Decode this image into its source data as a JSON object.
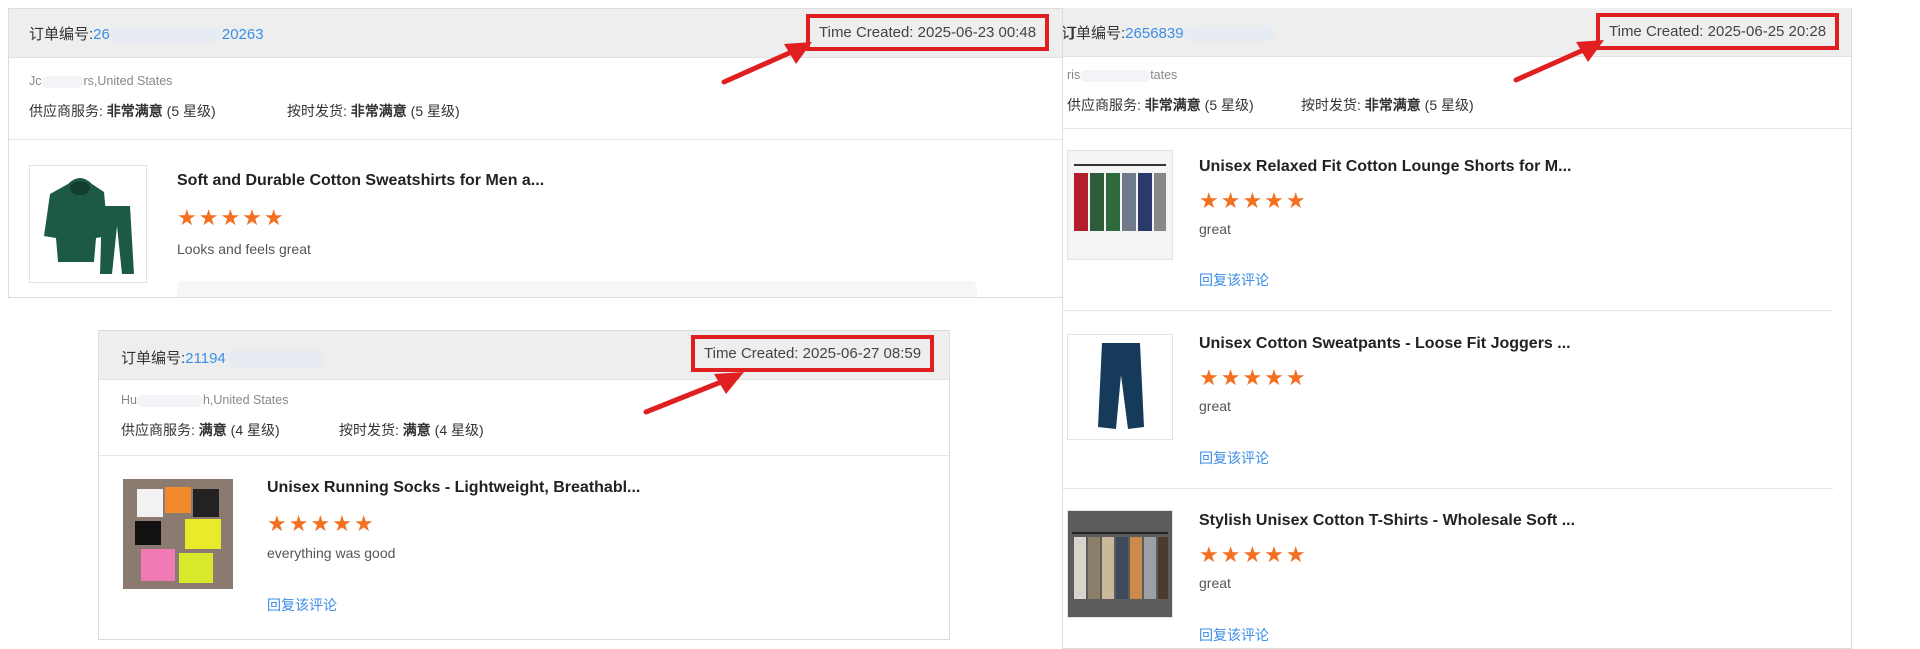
{
  "order_label": "订单编号:",
  "time_label": "Time Created:",
  "cards": {
    "c1": {
      "order_prefix": "26",
      "order_suffix": "20263",
      "time": "2025-06-23 00:48",
      "addr_prefix": "Jc",
      "addr_suffix": "rs,United States",
      "svc_label": "供应商服务:",
      "svc_value": "非常满意",
      "svc_level": "(5 星级)",
      "ship_label": "按时发货:",
      "ship_value": "非常满意",
      "ship_level": "(5 星级)",
      "product_title": "Soft and Durable Cotton Sweatshirts for Men a...",
      "stars": "★★★★★",
      "review": "Looks and feels great"
    },
    "c2": {
      "order_prefix": "21194",
      "time": "2025-06-27 08:59",
      "addr_prefix": "Hu",
      "addr_suffix": "h,United States",
      "svc_label": "供应商服务:",
      "svc_value": "满意",
      "svc_level": "(4 星级)",
      "ship_label": "按时发货:",
      "ship_value": "满意",
      "ship_level": "(4 星级)",
      "product_title": "Unisex Running Socks - Lightweight, Breathabl...",
      "stars": "★★★★★",
      "review": "everything was good",
      "reply": "回复该评论"
    },
    "c3": {
      "order_label_cut": "订单编号:",
      "order_prefix": "2656839",
      "time": "2025-06-25 20:28",
      "addr_prefix": "ris",
      "addr_suffix": "tates",
      "svc_label": "供应商服务:",
      "svc_value": "非常满意",
      "svc_level": "(5 星级)",
      "ship_label": "按时发货:",
      "ship_value": "非常满意",
      "ship_level": "(5 星级)",
      "items": [
        {
          "title": "Unisex Relaxed Fit Cotton Lounge Shorts for M...",
          "stars": "★★★★★",
          "review": "great",
          "reply": "回复该评论"
        },
        {
          "title": "Unisex Cotton Sweatpants - Loose Fit Joggers ...",
          "stars": "★★★★★",
          "review": "great",
          "reply": "回复该评论"
        },
        {
          "title": "Stylish Unisex Cotton T-Shirts - Wholesale Soft ...",
          "stars": "★★★★★",
          "review": "great",
          "reply": "回复该评论"
        }
      ]
    }
  }
}
